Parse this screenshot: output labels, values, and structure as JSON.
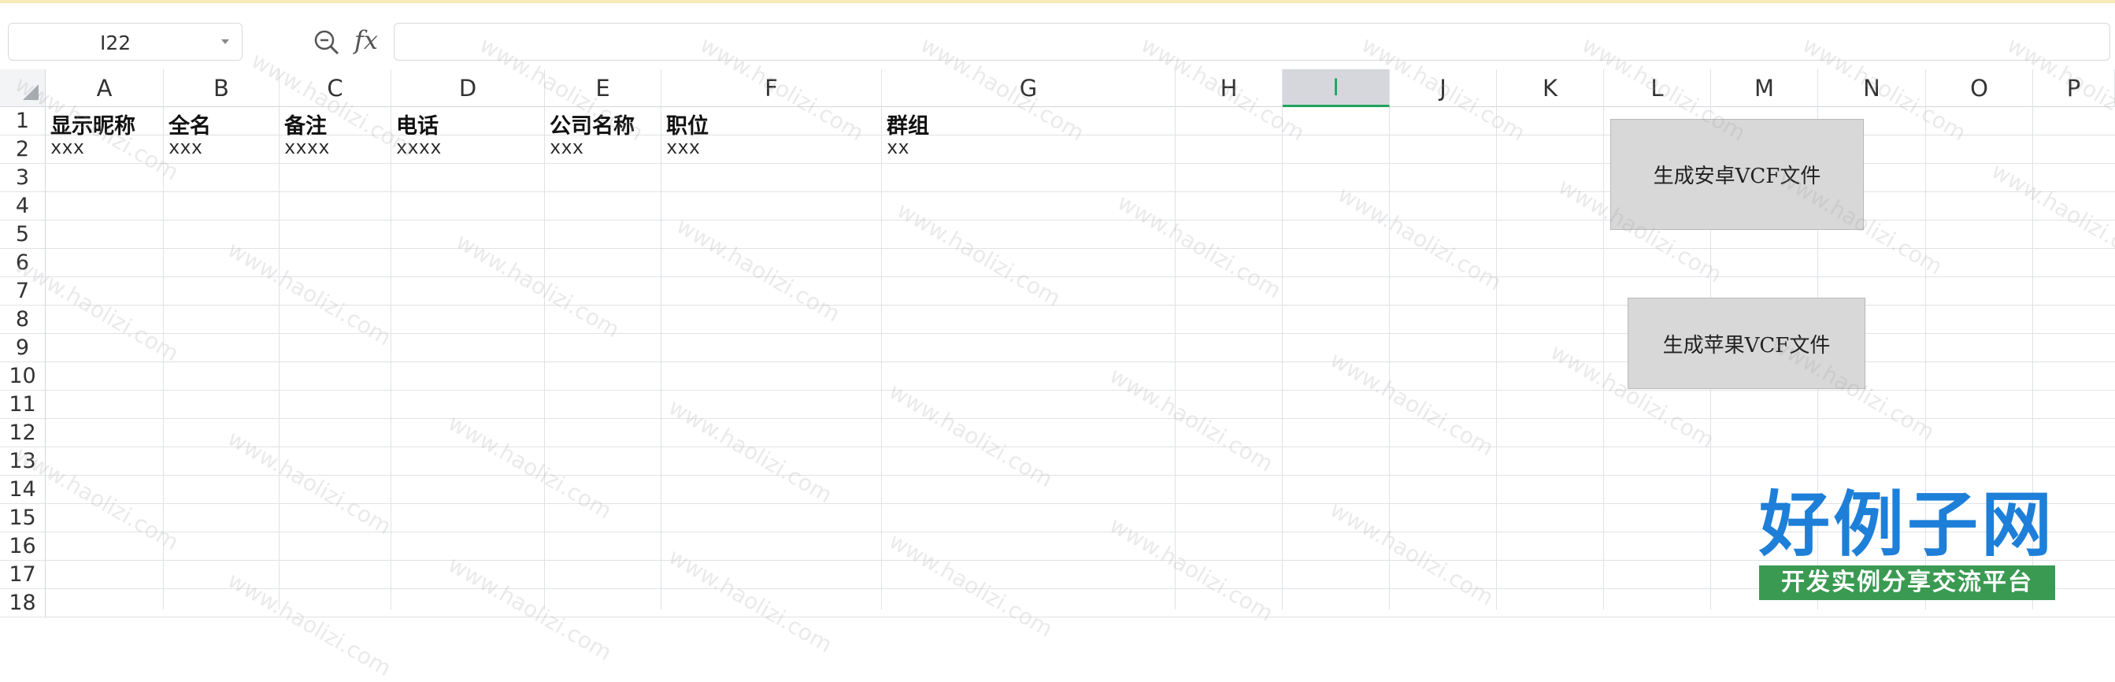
{
  "formula_bar": {
    "cell_ref": "I22",
    "formula_value": "",
    "zoom_icon": "zoom-magnifier-icon",
    "fx_label": "fx"
  },
  "sheet": {
    "columns": [
      "A",
      "B",
      "C",
      "D",
      "E",
      "F",
      "G",
      "H",
      "I",
      "J",
      "K",
      "L",
      "M",
      "N",
      "O",
      "P"
    ],
    "selected_column": "I",
    "rows": [
      "1",
      "2",
      "3",
      "4",
      "5",
      "6",
      "7",
      "8",
      "9",
      "10",
      "11",
      "12",
      "13",
      "14",
      "15",
      "16",
      "17",
      "18"
    ],
    "header_row": [
      "显示昵称",
      "全名",
      "备注",
      "电话",
      "公司名称",
      "职位",
      "群组"
    ],
    "data_row": [
      "xxx",
      "xxx",
      "xxxx",
      "xxxx",
      "xxx",
      "xxx",
      "xx"
    ]
  },
  "buttons": {
    "android": "生成安卓VCF文件",
    "apple": "生成苹果VCF文件"
  },
  "watermark": "www.haolizi.com",
  "logo": {
    "title": "好例子网",
    "subtitle": "开发实例分享交流平台"
  },
  "colors": {
    "selected_accent": "#1fa35c",
    "logo_blue": "#1e7fd8",
    "logo_green": "#3a9a52"
  }
}
